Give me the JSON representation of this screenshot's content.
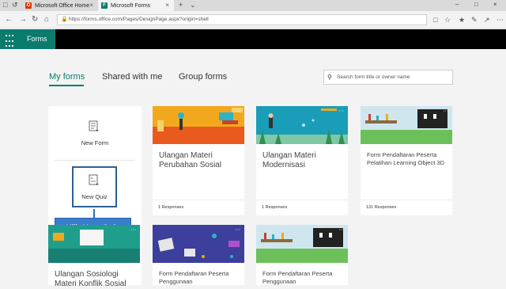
{
  "browser": {
    "tabs": [
      {
        "label": "Microsoft Office Home",
        "favicon_color": "#d83b01"
      },
      {
        "label": "Microsoft Forms",
        "favicon_color": "#0b7b6e"
      }
    ],
    "url": "https://forms.office.com/Pages/DesignPage.aspx?origin=shell"
  },
  "app": {
    "brand": "Forms",
    "accent": "#0b7b6e"
  },
  "nav": {
    "tabs": [
      {
        "label": "My forms",
        "active": true
      },
      {
        "label": "Shared with me",
        "active": false
      },
      {
        "label": "Group forms",
        "active": false
      }
    ],
    "search_placeholder": "Search form title or owner name"
  },
  "new": {
    "form_label": "New Form",
    "quiz_label": "New Quiz"
  },
  "tooltip": "Klik New Quiz",
  "cards": [
    {
      "title": "Ulangan Materi Perubahan Sosial",
      "responses": "1 Responses"
    },
    {
      "title": "Ulangan Materi Modernisasi",
      "responses": "1 Responses"
    },
    {
      "title": "Form Pendaftaran Peserta Pelatihan Learning Object 3D",
      "responses": "131 Responses"
    },
    {
      "title": "Ulangan Sosiologi Materi Konflik Sosial",
      "responses": ""
    },
    {
      "title": "Form Pendaftaran Peserta Penggunaan",
      "responses": ""
    },
    {
      "title": "Form Pendaftaran Peserta Penggunaan",
      "responses": ""
    }
  ]
}
